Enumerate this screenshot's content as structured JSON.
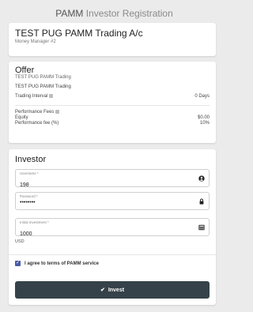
{
  "page": {
    "title_main": "PAMM",
    "title_rest": "Investor Registration"
  },
  "account": {
    "name": "TEST PUG PAMM Trading A/c",
    "manager": "Money Manager #2"
  },
  "offer": {
    "heading": "Offer",
    "subtitle": "TEST PUG PAMM Trading",
    "name": "TEST PUG PAMM Trading",
    "trading_interval_label": "Trading Interval",
    "trading_interval_value": "0 Days",
    "performance_fees_label": "Performance Fees",
    "equity_label": "Equity",
    "equity_value": "$0.00",
    "performance_fee_label": "Performance fee (%)",
    "performance_fee_value": "10%"
  },
  "investor": {
    "heading": "Investor",
    "username": {
      "label": "Username *",
      "value": "198"
    },
    "password": {
      "label": "Password *",
      "value": "••••••••"
    },
    "initial_investment": {
      "label": "Initial Investment *",
      "value": "1000"
    },
    "currency": "USD",
    "agree_label": "I agree to terms of PAMM service",
    "agree_checked": true,
    "invest_label": "Invest"
  },
  "colors": {
    "button_bg": "#354249",
    "checkbox": "#4a5aa8",
    "background": "#ebebeb"
  },
  "icons": {
    "username": "user-circle-icon",
    "password": "lock-icon",
    "investment": "calculator-icon",
    "invest": "check-icon"
  }
}
